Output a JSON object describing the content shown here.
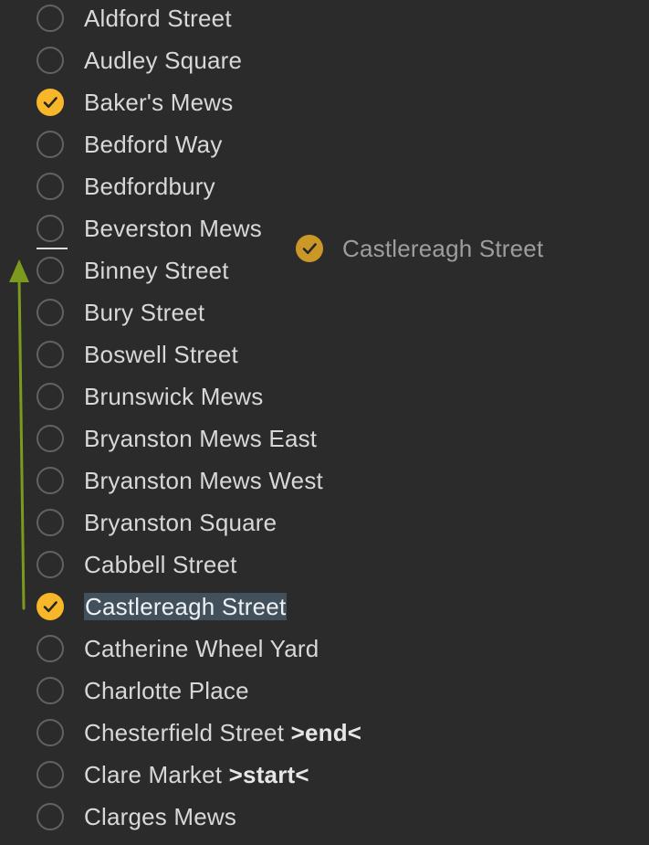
{
  "items": [
    {
      "label": "Aldford Street",
      "marker": "",
      "checked": false,
      "selected": false
    },
    {
      "label": "Audley Square",
      "marker": "",
      "checked": false,
      "selected": false
    },
    {
      "label": "Baker's Mews",
      "marker": "",
      "checked": true,
      "selected": false
    },
    {
      "label": "Bedford Way",
      "marker": "",
      "checked": false,
      "selected": false
    },
    {
      "label": "Bedfordbury",
      "marker": "",
      "checked": false,
      "selected": false
    },
    {
      "label": "Beverston Mews",
      "marker": "",
      "checked": false,
      "selected": false
    },
    {
      "label": "Binney Street",
      "marker": "",
      "checked": false,
      "selected": false
    },
    {
      "label": "Bury Street",
      "marker": "",
      "checked": false,
      "selected": false
    },
    {
      "label": "Boswell Street",
      "marker": "",
      "checked": false,
      "selected": false
    },
    {
      "label": "Brunswick Mews",
      "marker": "",
      "checked": false,
      "selected": false
    },
    {
      "label": "Bryanston Mews East",
      "marker": "",
      "checked": false,
      "selected": false
    },
    {
      "label": "Bryanston Mews West",
      "marker": "",
      "checked": false,
      "selected": false
    },
    {
      "label": "Bryanston Square",
      "marker": "",
      "checked": false,
      "selected": false
    },
    {
      "label": "Cabbell Street",
      "marker": "",
      "checked": false,
      "selected": false
    },
    {
      "label": "Castlereagh Street",
      "marker": "",
      "checked": true,
      "selected": true
    },
    {
      "label": "Catherine Wheel Yard",
      "marker": "",
      "checked": false,
      "selected": false
    },
    {
      "label": "Charlotte Place",
      "marker": "",
      "checked": false,
      "selected": false
    },
    {
      "label": "Chesterfield Street",
      "marker": ">end<",
      "checked": false,
      "selected": false
    },
    {
      "label": "Clare Market",
      "marker": ">start<",
      "checked": false,
      "selected": false
    },
    {
      "label": "Clarges Mews",
      "marker": "",
      "checked": false,
      "selected": false
    }
  ],
  "drag_ghost": {
    "label": "Castlereagh Street",
    "checked": true
  },
  "colors": {
    "background": "#2b2b2b",
    "checked_fill": "#f8b728",
    "unchecked_ring": "#626262",
    "selection_highlight": "#42505b",
    "move_arrow": "#7c9a1e",
    "drop_indicator": "#dcdcdc"
  },
  "icons": {
    "unchecked": "circle-outline-icon",
    "checked": "checkmark-circle-icon",
    "move": "arrow-up-icon"
  }
}
